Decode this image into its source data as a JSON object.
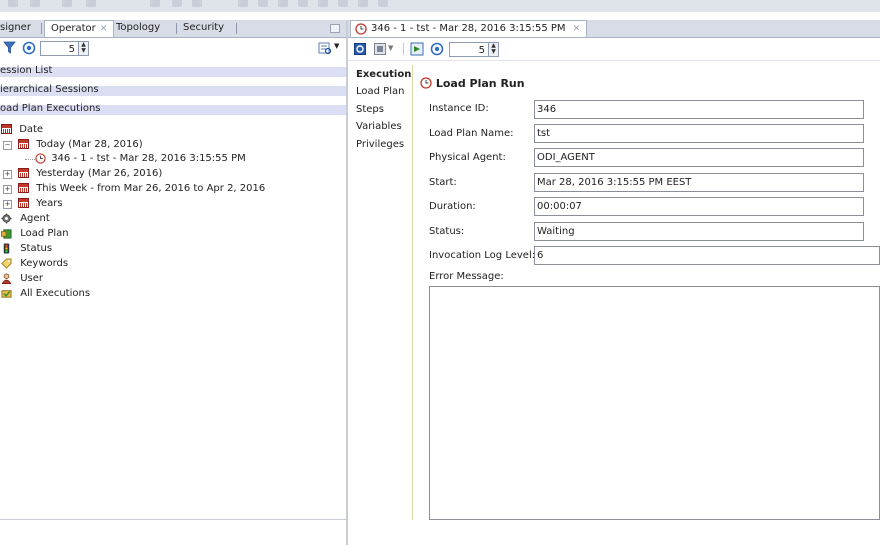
{
  "left_panel": {
    "tabs": [
      {
        "label": "signer",
        "active": false
      },
      {
        "label": "Operator",
        "active": true
      },
      {
        "label": "Topology",
        "active": false
      },
      {
        "label": "Security",
        "active": false
      }
    ],
    "toolbar": {
      "count_value": "5"
    },
    "accordions": [
      {
        "label": "ession List"
      },
      {
        "label": "ierarchical Sessions"
      },
      {
        "label": "oad Plan Executions"
      }
    ],
    "tree": [
      {
        "label": "Date"
      },
      {
        "label": "Today (Mar 28, 2016)",
        "expander": "−"
      },
      {
        "label": "346 - 1 - tst - Mar 28, 2016 3:15:55 PM"
      },
      {
        "label": "Yesterday (Mar 26, 2016)",
        "expander": "+"
      },
      {
        "label": "This Week - from Mar 26, 2016 to Apr 2, 2016",
        "expander": "+"
      },
      {
        "label": "Years",
        "expander": "+"
      },
      {
        "label": "Agent"
      },
      {
        "label": "Load Plan"
      },
      {
        "label": "Status"
      },
      {
        "label": "Keywords"
      },
      {
        "label": "User"
      },
      {
        "label": "All Executions"
      }
    ]
  },
  "editor": {
    "tab_label": "346 - 1 - tst - Mar 28, 2016 3:15:55 PM",
    "toolbar": {
      "count_value": "5"
    },
    "vertical_tabs": [
      {
        "label": "Execution",
        "active": true
      },
      {
        "label": "Load Plan"
      },
      {
        "label": "Steps"
      },
      {
        "label": "Variables"
      },
      {
        "label": "Privileges"
      }
    ],
    "section_title": "Load Plan Run",
    "fields": {
      "instance_id": {
        "label": "Instance ID:",
        "value": "346"
      },
      "load_plan_name": {
        "label": "Load Plan Name:",
        "value": "tst"
      },
      "physical_agent": {
        "label": "Physical Agent:",
        "value": "ODI_AGENT"
      },
      "start": {
        "label": "Start:",
        "value": "Mar 28, 2016 3:15:55 PM EEST"
      },
      "duration": {
        "label": "Duration:",
        "value": "00:00:07"
      },
      "status": {
        "label": "Status:",
        "value": "Waiting"
      },
      "invocation_log_level": {
        "label": "Invocation Log Level:",
        "value": "6"
      },
      "error_message": {
        "label": "Error Message:",
        "value": ""
      }
    }
  }
}
